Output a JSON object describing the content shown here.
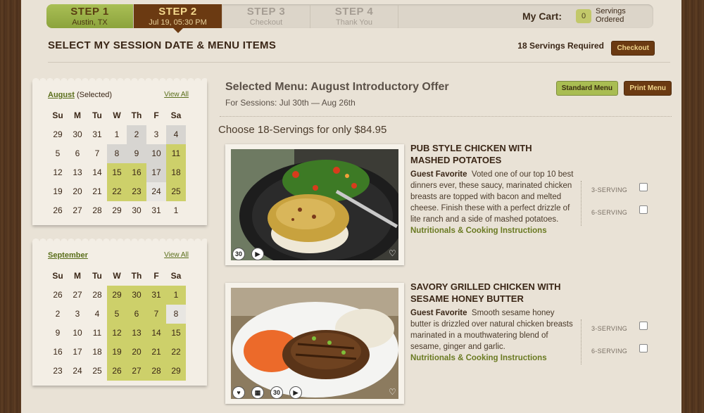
{
  "steps": [
    {
      "num": "STEP 1",
      "sub": "Austin, TX"
    },
    {
      "num": "STEP 2",
      "sub": "Jul 19, 05:30 PM"
    },
    {
      "num": "STEP 3",
      "sub": "Checkout"
    },
    {
      "num": "STEP 4",
      "sub": "Thank You"
    }
  ],
  "cart": {
    "label": "My Cart:",
    "count": "0",
    "sub_line1": "Servings",
    "sub_line2": "Ordered"
  },
  "page_title": "SELECT MY SESSION DATE & MENU ITEMS",
  "servings_required": "18 Servings Required",
  "checkout_label": "Checkout",
  "calendars": {
    "august": {
      "month": "August",
      "selected_note": "(Selected)",
      "view_all": "View All",
      "headers": [
        "Su",
        "Mo",
        "Tu",
        "We",
        "Th",
        "Fr",
        "Sa"
      ],
      "header_labels": [
        "Su",
        "M",
        "Tu",
        "W",
        "Th",
        "F",
        "Sa"
      ]
    },
    "september": {
      "month": "September",
      "view_all": "View All",
      "header_labels": [
        "Su",
        "M",
        "Tu",
        "W",
        "Th",
        "F",
        "Sa"
      ]
    }
  },
  "aug_weeks": [
    [
      [
        "29",
        ""
      ],
      [
        "30",
        ""
      ],
      [
        "31",
        ""
      ],
      [
        "1",
        ""
      ],
      [
        "2",
        "gray"
      ],
      [
        "3",
        ""
      ],
      [
        "4",
        "gray"
      ]
    ],
    [
      [
        "5",
        ""
      ],
      [
        "6",
        ""
      ],
      [
        "7",
        ""
      ],
      [
        "8",
        "gray"
      ],
      [
        "9",
        "gray"
      ],
      [
        "10",
        "gray"
      ],
      [
        "11",
        "green"
      ]
    ],
    [
      [
        "12",
        ""
      ],
      [
        "13",
        ""
      ],
      [
        "14",
        ""
      ],
      [
        "15",
        "green"
      ],
      [
        "16",
        "green"
      ],
      [
        "17",
        "gray"
      ],
      [
        "18",
        "green"
      ]
    ],
    [
      [
        "19",
        ""
      ],
      [
        "20",
        ""
      ],
      [
        "21",
        ""
      ],
      [
        "22",
        "green"
      ],
      [
        "23",
        "green"
      ],
      [
        "24",
        "light"
      ],
      [
        "25",
        "green"
      ]
    ],
    [
      [
        "26",
        ""
      ],
      [
        "27",
        ""
      ],
      [
        "28",
        ""
      ],
      [
        "29",
        ""
      ],
      [
        "30",
        ""
      ],
      [
        "31",
        ""
      ],
      [
        "1",
        ""
      ]
    ]
  ],
  "sep_weeks": [
    [
      [
        "26",
        ""
      ],
      [
        "27",
        ""
      ],
      [
        "28",
        ""
      ],
      [
        "29",
        "green"
      ],
      [
        "30",
        "green"
      ],
      [
        "31",
        "green"
      ],
      [
        "1",
        "green"
      ]
    ],
    [
      [
        "2",
        ""
      ],
      [
        "3",
        ""
      ],
      [
        "4",
        ""
      ],
      [
        "5",
        "green"
      ],
      [
        "6",
        "green"
      ],
      [
        "7",
        "green"
      ],
      [
        "8",
        "light"
      ]
    ],
    [
      [
        "9",
        ""
      ],
      [
        "10",
        ""
      ],
      [
        "11",
        ""
      ],
      [
        "12",
        "green"
      ],
      [
        "13",
        "green"
      ],
      [
        "14",
        "green"
      ],
      [
        "15",
        "green"
      ]
    ],
    [
      [
        "16",
        ""
      ],
      [
        "17",
        ""
      ],
      [
        "18",
        ""
      ],
      [
        "19",
        "green"
      ],
      [
        "20",
        "green"
      ],
      [
        "21",
        "green"
      ],
      [
        "22",
        "green"
      ]
    ],
    [
      [
        "23",
        ""
      ],
      [
        "24",
        ""
      ],
      [
        "25",
        ""
      ],
      [
        "26",
        "green"
      ],
      [
        "27",
        "green"
      ],
      [
        "28",
        "green"
      ],
      [
        "29",
        "green"
      ]
    ]
  ],
  "menu": {
    "title": "Selected Menu: August Introductory Offer",
    "sessions": "For Sessions: Jul 30th — Aug 26th",
    "standard_label": "Standard Menu",
    "print_label": "Print Menu",
    "choose": "Choose 18-Servings for only $84.95"
  },
  "items": [
    {
      "name": "PUB STYLE CHICKEN WITH MASHED POTATOES",
      "tag": "Guest Favorite",
      "desc": "Voted one of our top 10 best dinners ever, these saucy, marinated chicken breasts are topped with bacon and melted cheese. Finish these with a perfect drizzle of lite ranch and a side of mashed potatoes.",
      "link": "Nutritionals & Cooking Instructions",
      "serv3": "3-SERVING",
      "serv6": "6-SERVING"
    },
    {
      "name": "SAVORY GRILLED CHICKEN WITH SESAME HONEY BUTTER",
      "tag": "Guest Favorite",
      "desc": "Smooth sesame honey butter is drizzled over natural chicken breasts marinated in a mouthwatering blend of sesame, ginger and garlic.",
      "link": "Nutritionals & Cooking Instructions",
      "serv3": "3-SERVING",
      "serv6": "6-SERVING"
    }
  ],
  "icons": {
    "thirty": "30",
    "video": "video-icon",
    "heart": "heart-icon"
  }
}
